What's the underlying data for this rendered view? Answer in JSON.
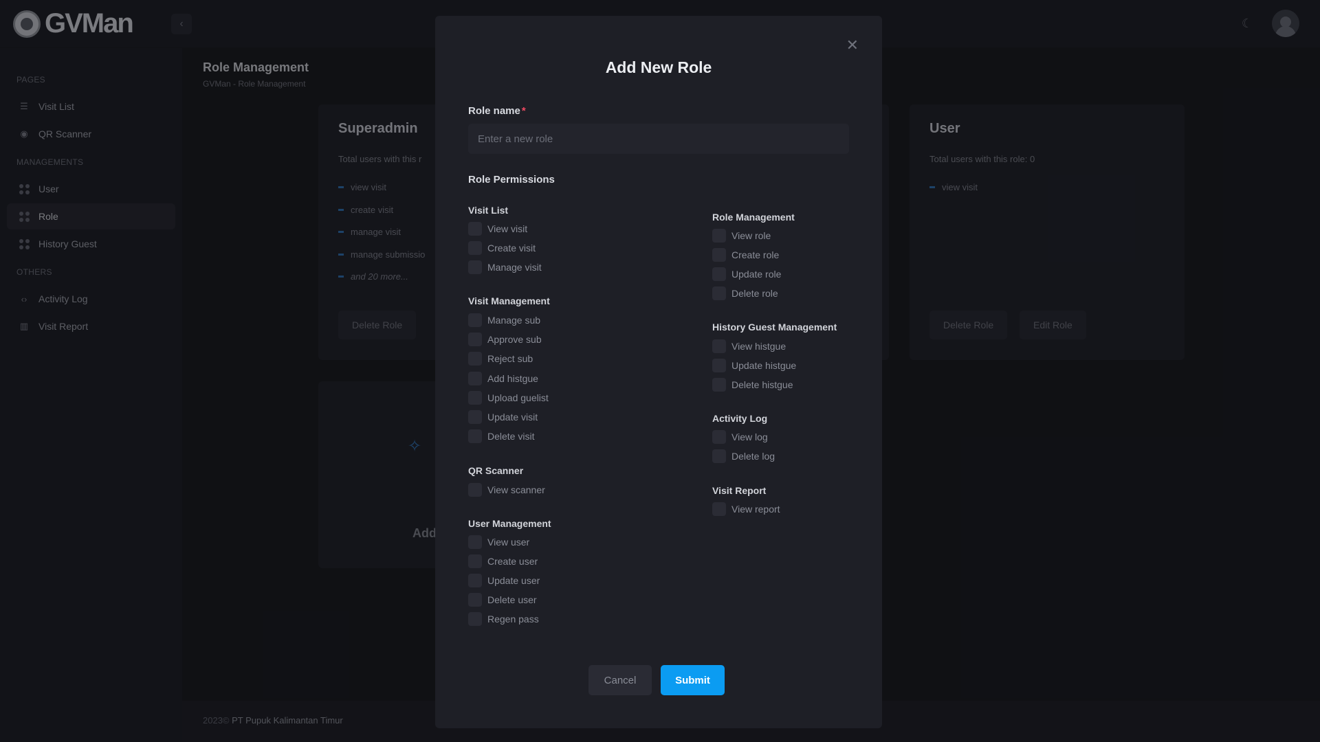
{
  "app": {
    "name": "GVMan"
  },
  "sidebar": {
    "sections": [
      {
        "label": "PAGES",
        "items": [
          {
            "label": "Visit List",
            "icon": "list-icon"
          },
          {
            "label": "QR Scanner",
            "icon": "target-icon"
          }
        ]
      },
      {
        "label": "MANAGEMENTS",
        "items": [
          {
            "label": "User",
            "icon": "grid-dots-icon"
          },
          {
            "label": "Role",
            "icon": "grid-dots-icon",
            "active": true
          },
          {
            "label": "History Guest",
            "icon": "grid-dots-icon"
          }
        ]
      },
      {
        "label": "OTHERS",
        "items": [
          {
            "label": "Activity Log",
            "icon": "code-icon"
          },
          {
            "label": "Visit Report",
            "icon": "bar-chart-icon"
          }
        ]
      }
    ]
  },
  "page": {
    "title": "Role Management",
    "breadcrumb": "GVMan - Role Management"
  },
  "cards": {
    "superadmin": {
      "name": "Superadmin",
      "total": "Total users with this r",
      "perms": [
        "view visit",
        "create visit",
        "manage visit",
        "manage submissio",
        "and 20 more..."
      ],
      "delete_label": "Delete Role"
    },
    "user": {
      "name": "User",
      "total": "Total users with this role: 0",
      "perms": [
        "view visit"
      ],
      "delete_label": "Delete Role",
      "edit_label": "Edit Role"
    },
    "add": {
      "label": "Add"
    }
  },
  "footer": {
    "year": "2023©",
    "company": "PT Pupuk Kalimantan Timur"
  },
  "modal": {
    "title": "Add New Role",
    "role_name_label": "Role name",
    "required_mark": "*",
    "role_name_placeholder": "Enter a new role",
    "role_name_value": "",
    "permissions_title": "Role Permissions",
    "groups_left": [
      {
        "title": "Visit List",
        "items": [
          "View visit",
          "Create visit",
          "Manage visit"
        ]
      },
      {
        "title": "Visit Management",
        "items": [
          "Manage sub",
          "Approve sub",
          "Reject sub",
          "Add histgue",
          "Upload guelist",
          "Update visit",
          "Delete visit"
        ]
      },
      {
        "title": "QR Scanner",
        "items": [
          "View scanner"
        ]
      },
      {
        "title": "User Management",
        "items": [
          "View user",
          "Create user",
          "Update user",
          "Delete user",
          "Regen pass"
        ]
      }
    ],
    "groups_right": [
      {
        "title": "Role Management",
        "items": [
          "View role",
          "Create role",
          "Update role",
          "Delete role"
        ]
      },
      {
        "title": "History Guest Management",
        "items": [
          "View histgue",
          "Update histgue",
          "Delete histgue"
        ]
      },
      {
        "title": "Activity Log",
        "items": [
          "View log",
          "Delete log"
        ]
      },
      {
        "title": "Visit Report",
        "items": [
          "View report"
        ]
      }
    ],
    "cancel_label": "Cancel",
    "submit_label": "Submit"
  },
  "colors": {
    "accent": "#0b9cf2",
    "required": "#ef4a62",
    "background": "#1a1a22"
  }
}
